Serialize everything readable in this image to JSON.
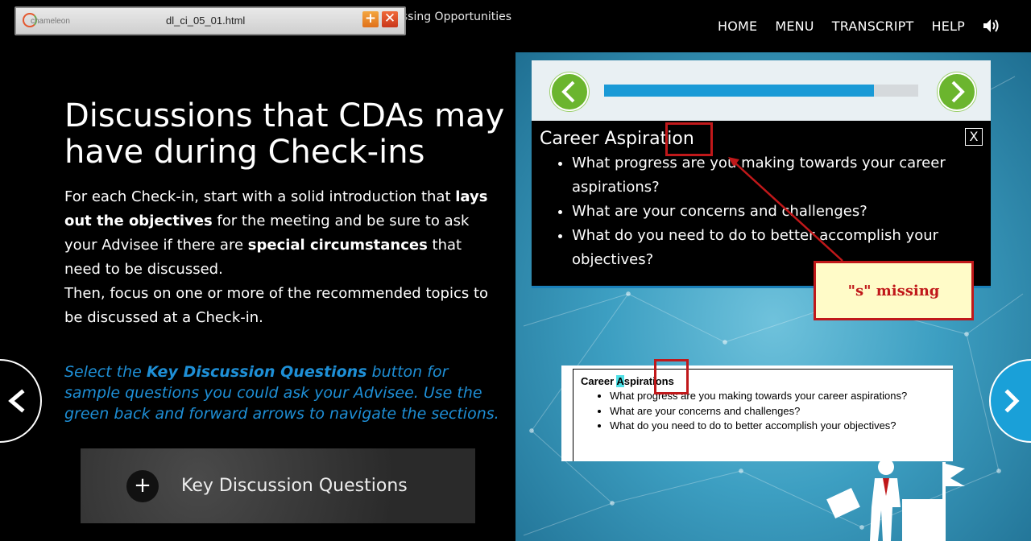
{
  "header": {
    "course_title": "ussing Opportunities",
    "nav": [
      "HOME",
      "MENU",
      "TRANSCRIPT",
      "HELP"
    ]
  },
  "chameleon": {
    "brand": "chameleon",
    "filename": "dl_ci_05_01.html",
    "plus_label": "+",
    "close_label": "✕"
  },
  "main": {
    "heading": "Discussions that CDAs may have during Check-ins",
    "para1": {
      "t1": "For each Check-in, start with a solid introduction that ",
      "b1": "lays out the objectives",
      "t2": " for the meeting and be sure to ask your Advisee if there are ",
      "b2": "special circumstances",
      "t3": " that need to be discussed."
    },
    "para2": "Then, focus on one or more of the recommended topics to be discussed at a Check-in.",
    "instruction": {
      "t1": "Select the ",
      "b1": "Key Discussion Questions",
      "t2": " button for sample questions you could ask your Advisee. Use the green back and forward arrows to navigate the sections."
    },
    "kdq_button": {
      "icon": "+",
      "label": "Key Discussion Questions"
    }
  },
  "panel": {
    "progress": 0.86,
    "title": "Career Aspiration",
    "close": "X",
    "questions": [
      "What progress are you making towards your career aspirations?",
      "What are your concerns and challenges?",
      "What do you need to do to better accomplish your objectives?"
    ]
  },
  "document": {
    "title_pre": "Career ",
    "title_hl": "A",
    "title_post": "spirations",
    "bullets": [
      "What progress are you making towards your career aspirations?",
      "What are your concerns and challenges?",
      "What do you need to do to better accomplish your objectives?"
    ]
  },
  "annotation": {
    "callout": "\"s\" missing"
  },
  "colors": {
    "accent_blue": "#1a9ad6",
    "arrow_green": "#6bb52e",
    "annotation_red": "#c0181a",
    "callout_bg": "#fffbc8"
  }
}
